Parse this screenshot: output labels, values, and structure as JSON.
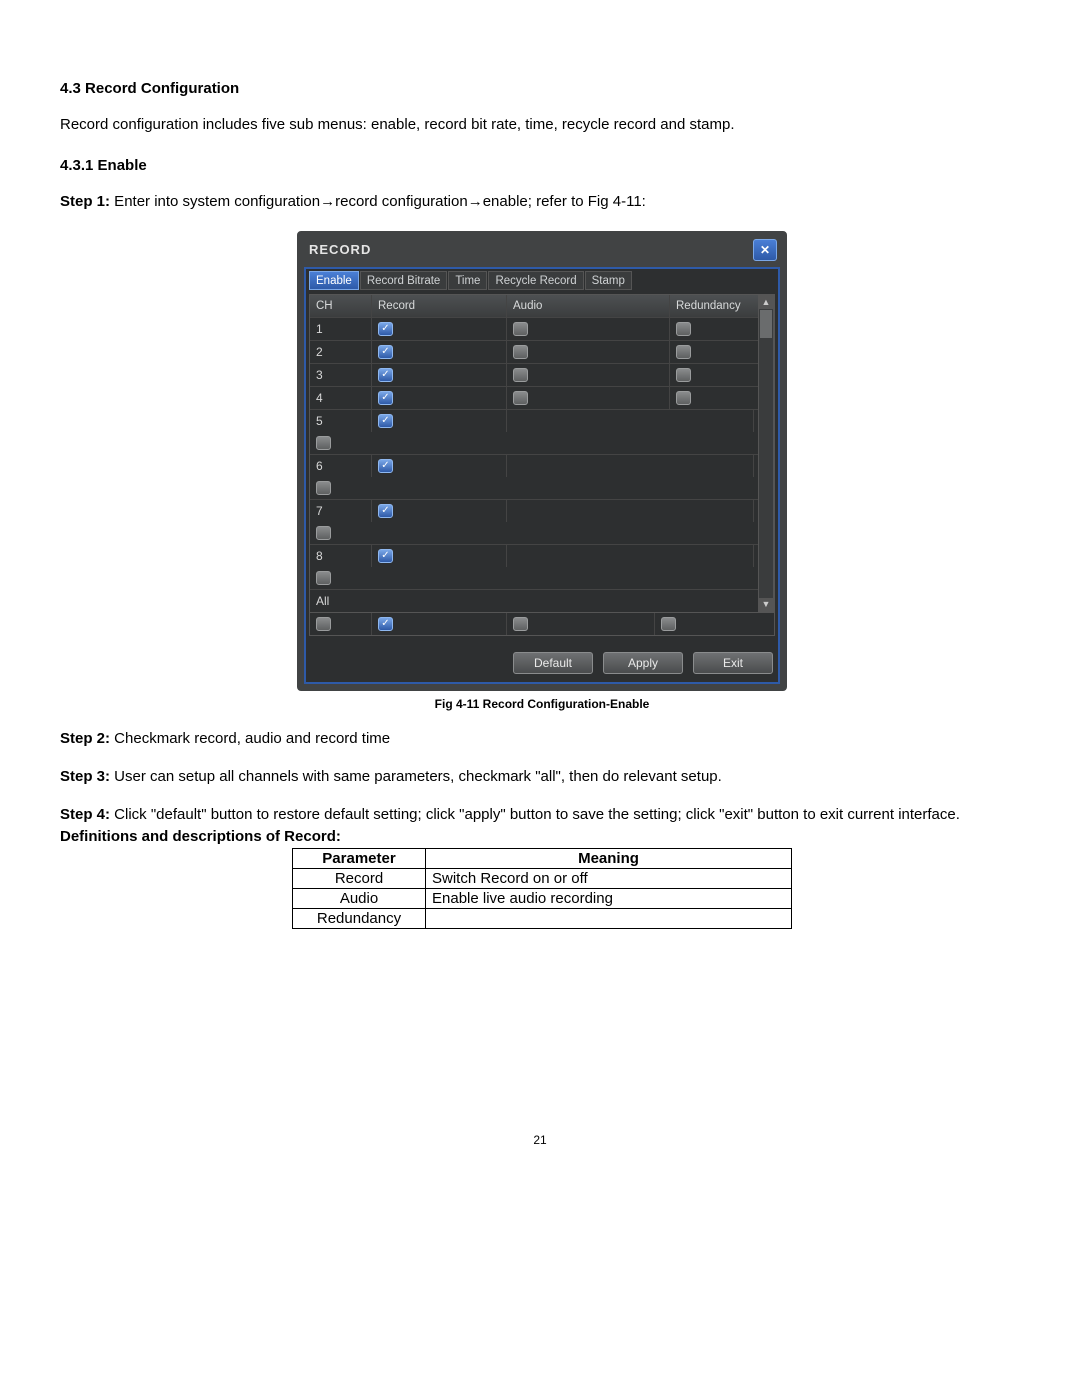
{
  "section": {
    "title": "4.3 Record Configuration",
    "intro": "Record configuration includes five sub menus: enable, record bit rate, time, recycle record and stamp.",
    "sub_title": "4.3.1 Enable",
    "step1_label": "Step 1:",
    "step1_text": " Enter into system configuration→record configuration→enable; refer to Fig 4-11:"
  },
  "dvr": {
    "title": "RECORD",
    "close_glyph": "✕",
    "tabs": [
      "Enable",
      "Record Bitrate",
      "Time",
      "Recycle Record",
      "Stamp"
    ],
    "active_tab_index": 0,
    "columns": [
      "CH",
      "Record",
      "Audio",
      "Redundancy"
    ],
    "channels": [
      {
        "ch": "1",
        "record": true,
        "audio": false,
        "redundancy": false
      },
      {
        "ch": "2",
        "record": true,
        "audio": false,
        "redundancy": false
      },
      {
        "ch": "3",
        "record": true,
        "audio": false,
        "redundancy": false
      },
      {
        "ch": "4",
        "record": true,
        "audio": false,
        "redundancy": false
      },
      {
        "ch": "5",
        "record": true,
        "audio": null,
        "redundancy": false
      },
      {
        "ch": "6",
        "record": true,
        "audio": null,
        "redundancy": false
      },
      {
        "ch": "7",
        "record": true,
        "audio": null,
        "redundancy": false
      },
      {
        "ch": "8",
        "record": true,
        "audio": null,
        "redundancy": false
      }
    ],
    "all_row": {
      "label": "All",
      "record": true,
      "audio": false,
      "redundancy": false
    },
    "buttons": {
      "default": "Default",
      "apply": "Apply",
      "exit": "Exit"
    },
    "caption": "Fig 4-11 Record Configuration-Enable"
  },
  "steps": {
    "s2_label": "Step 2:",
    "s2_text": " Checkmark record, audio and record time",
    "s3_label": "Step 3:",
    "s3_text": " User can setup all channels with same parameters, checkmark \"all\", then do relevant setup.",
    "s4_label": "Step 4:",
    "s4_text": " Click \"default\" button to restore default setting; click \"apply\" button to save the setting; click \"exit\" button to exit current interface.",
    "defs_title": "Definitions and descriptions of Record:"
  },
  "param_table": {
    "headers": [
      "Parameter",
      "Meaning"
    ],
    "rows": [
      {
        "p": "Record",
        "m": "Switch Record on or off"
      },
      {
        "p": "Audio",
        "m": "Enable live audio recording"
      },
      {
        "p": "Redundancy",
        "m": ""
      }
    ]
  },
  "page_number": "21"
}
